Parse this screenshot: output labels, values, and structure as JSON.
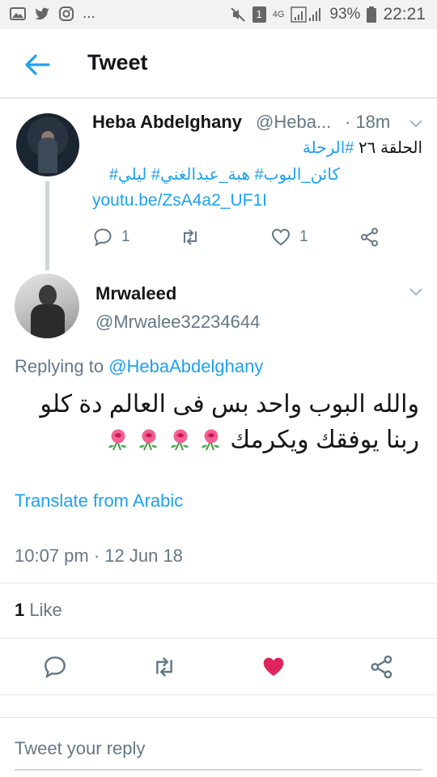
{
  "status_bar": {
    "battery": "93%",
    "time": "22:21",
    "network": "4G",
    "sim_badge": "1",
    "dots": "...",
    "icons": [
      "gallery-icon",
      "twitter-bird-icon",
      "instagram-icon",
      "mute-icon",
      "sim-icon",
      "signal-icon",
      "battery-icon"
    ]
  },
  "header": {
    "title": "Tweet",
    "back_icon": "back-arrow-icon"
  },
  "parent_tweet": {
    "name": "Heba Abdelghany",
    "handle": "@Heba...",
    "time": "· 18m",
    "line1_text": "الحلقة ٢٦",
    "line1_tag": "#الرحلة",
    "line2": "كائن_البوب# هبة_عبدالغني# ليلي#",
    "link": "youtu.be/ZsA4a2_UF1I",
    "reply_count": "1",
    "like_count": "1"
  },
  "reply_tweet": {
    "name": "Mrwaleed",
    "handle": "@Mrwalee32234644",
    "replying_prefix": "Replying to",
    "replying_to": "@HebaAbdelghany",
    "line1": "والله البوب واحد بس فى العالم دة كلو",
    "line2": "ربنا يوفقك ويكرمك",
    "translate": "Translate from Arabic",
    "timestamp": "10:07 pm · 12 Jun 18",
    "like_count": "1",
    "like_label": "Like"
  },
  "reply_input": {
    "placeholder": "Tweet your reply"
  },
  "colors": {
    "accent": "#1da1f2",
    "secondary_text": "#657786",
    "like_active": "#e0245e",
    "divider": "#e1e8ed"
  }
}
